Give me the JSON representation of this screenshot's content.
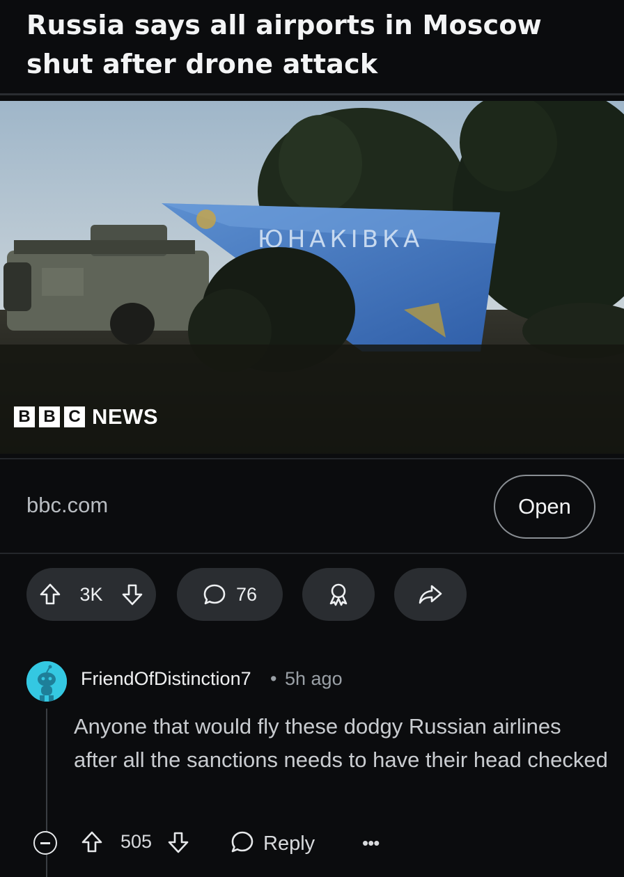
{
  "post": {
    "title": "Russia says all airports in Moscow shut after drone attack",
    "image": {
      "logo_letters": [
        "B",
        "B",
        "C"
      ],
      "logo_text": "NEWS"
    },
    "link_domain": "bbc.com",
    "open_label": "Open",
    "votes": "3K",
    "comments": "76"
  },
  "comment": {
    "author": "FriendOfDistinction7",
    "separator": "•",
    "time": "5h ago",
    "body": "Anyone that would fly these dodgy Russian airlines after all the sanctions needs to have their head checked",
    "score": "505",
    "reply_label": "Reply",
    "more_label": "•••"
  },
  "icons": [
    "upvote-icon",
    "downvote-icon",
    "comment-icon",
    "award-icon",
    "share-icon",
    "collapse-icon",
    "reply-icon",
    "more-icon"
  ]
}
